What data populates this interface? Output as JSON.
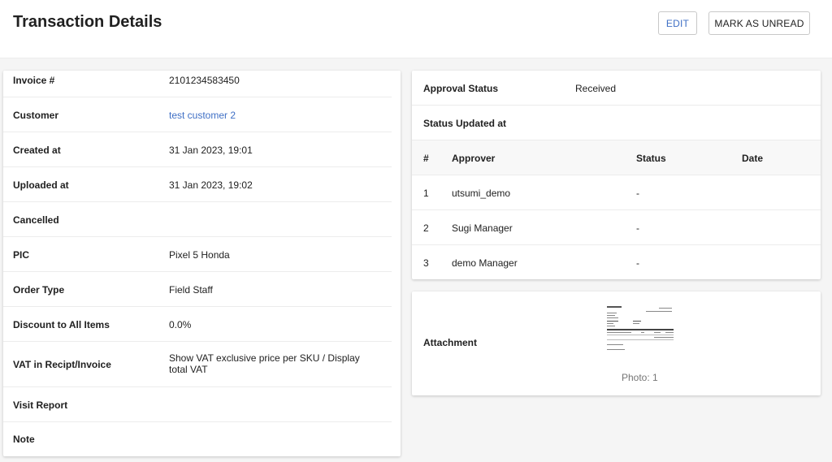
{
  "header": {
    "title": "Transaction Details",
    "edit_label": "EDIT",
    "mark_unread_label": "MARK AS UNREAD"
  },
  "details": [
    {
      "label": "Invoice #",
      "value": "2101234583450"
    },
    {
      "label": "Customer",
      "value": "test customer 2"
    },
    {
      "label": "Created at",
      "value": "31 Jan 2023, 19:01"
    },
    {
      "label": "Uploaded at",
      "value": "31 Jan 2023, 19:02"
    },
    {
      "label": "Cancelled",
      "value": ""
    },
    {
      "label": "PIC",
      "value": "Pixel 5 Honda"
    },
    {
      "label": "Order Type",
      "value": "Field Staff"
    },
    {
      "label": "Discount to All Items",
      "value": "0.0%"
    },
    {
      "label": "VAT in Recipt/Invoice",
      "value": "Show VAT exclusive price per SKU / Display total VAT"
    },
    {
      "label": "Visit Report",
      "value": ""
    },
    {
      "label": "Note",
      "value": ""
    }
  ],
  "approval": {
    "status_label": "Approval Status",
    "status_value": "Received",
    "updated_label": "Status Updated at",
    "columns": [
      "#",
      "Approver",
      "Status",
      "Date"
    ],
    "rows": [
      {
        "num": "1",
        "approver": "utsumi_demo",
        "status": "-",
        "date": ""
      },
      {
        "num": "2",
        "approver": "Sugi Manager",
        "status": "-",
        "date": ""
      },
      {
        "num": "3",
        "approver": "demo Manager",
        "status": "-",
        "date": ""
      }
    ]
  },
  "attachment": {
    "label": "Attachment",
    "photo_count": "Photo: 1"
  },
  "colors": {
    "link": "#3f6fc5",
    "background": "#f5f5f5"
  }
}
